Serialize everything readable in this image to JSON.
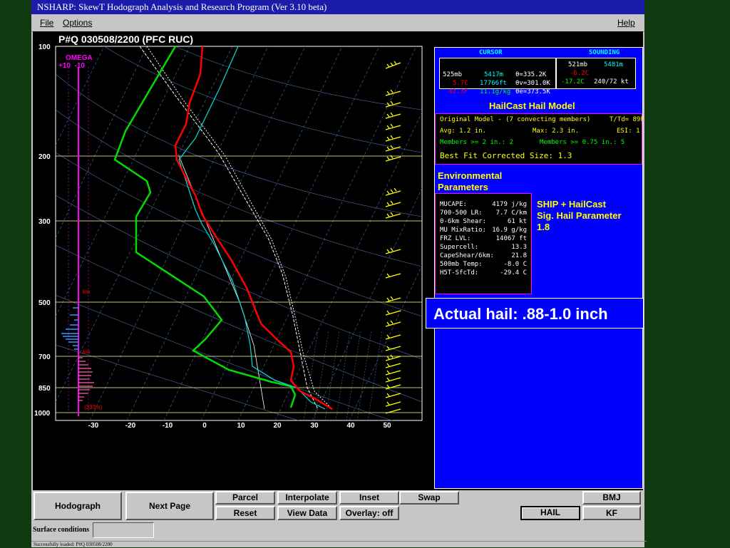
{
  "window": {
    "title": "NSHARP: SkewT Hodograph Analysis and Research Program (Ver 3.10 beta)",
    "menu": {
      "file": "File",
      "options": "Options",
      "help": "Help"
    }
  },
  "skewt": {
    "header": "P#Q   030508/2200  (PFC RUC)",
    "omega_label": "OMEGA",
    "omega_scale": "+10  -10",
    "pressure_labels": [
      "100",
      "200",
      "300",
      "500",
      "700",
      "850",
      "1000"
    ],
    "temp_labels": [
      "-30",
      "-20",
      "-10",
      "0",
      "10",
      "20",
      "30",
      "40",
      "50"
    ],
    "height_labels": [
      "km",
      "km",
      "(333m)"
    ]
  },
  "cursor_panel": {
    "title_left": "CURSOR",
    "title_right": "SOUNDING",
    "cursor": {
      "r1a": "525mb",
      "r1b": "5417m",
      "r1c": "θ=335.2K",
      "r2a": "5.7C",
      "r2b": "17766ft",
      "r2c": "θv=301.0K",
      "r3a": "42.3F",
      "r3b": "11.1g/kg",
      "r3c": "θe=373.5K"
    },
    "sounding": {
      "r1a": "521mb",
      "r1b": "5481m",
      "r2a": "-6.2C",
      "r3a": "-17.2C",
      "r3b": "240/72 kt"
    }
  },
  "hailcast": {
    "title": "HailCast Hail Model",
    "line1": "Original Model - (7 convecting members)",
    "line1b": "T/Td= 89F",
    "line2a": "Avg: 1.2 in.",
    "line2b": "Max: 2.3 in.",
    "line2c": "ESI: 1",
    "line3a": "Members >= 2 in.:  2",
    "line3b": "Members >= 0.75 in.: 5",
    "line4": "Best Fit Corrected Size: 1.3"
  },
  "env": {
    "title1": "Environmental",
    "title2": "Parameters",
    "rows": [
      {
        "label": "MUCAPE:",
        "value": "4179 j/kg"
      },
      {
        "label": "700-500 LR:",
        "value": "7.7 C/km"
      },
      {
        "label": "0-6km Shear:",
        "value": "61 kt"
      },
      {
        "label": "MU MixRatio:",
        "value": "16.9 g/kg"
      },
      {
        "label": "FRZ LVL:",
        "value": "14067 ft"
      },
      {
        "label": "Supercell:",
        "value": "13.3"
      },
      {
        "label": "CapeShear/6km:",
        "value": "21.8"
      },
      {
        "label": "500mb Temp:",
        "value": "-8.0 C"
      },
      {
        "label": "H5T-SfcTd:",
        "value": "-29.4 C"
      }
    ],
    "ship_line1": "SHIP + HailCast",
    "ship_line2": "Sig. Hail Parameter",
    "ship_value": "1.8"
  },
  "annotation": {
    "actual_hail": "Actual hail: .88-1.0 inch"
  },
  "buttons": {
    "hodograph": "Hodograph",
    "next_page": "Next Page",
    "parcel": "Parcel",
    "interpolate": "Interpolate",
    "inset": "Inset",
    "swap": "Swap",
    "bmj": "BMJ",
    "reset": "Reset",
    "view_data": "View Data",
    "overlay": "Overlay: off",
    "hail": "HAIL",
    "kf": "KF"
  },
  "surface": {
    "label": "Surface conditions",
    "value": ""
  },
  "status": "Successfully loaded: P#Q  030508/2200",
  "colors": {
    "temperature": "#ff0000",
    "dewpoint": "#00ffff",
    "wetbulb_like": "#00cc00",
    "parcel": "#ffffff",
    "omega": "#ff00ff",
    "barbs": "#ffff00",
    "panel_bg": "#0000ff",
    "title_bar": "#1c1caa"
  }
}
